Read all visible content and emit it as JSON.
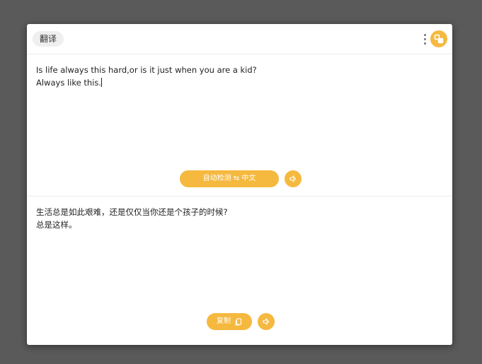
{
  "window": {
    "title": "翻译"
  },
  "source": {
    "text": "Is life always this hard,or is it just when you are a kid?\nAlways like this.",
    "language_button": "自动检测 ⇆ 中文"
  },
  "target": {
    "text": "生活总是如此艰难，还是仅仅当你还是个孩子的时候?\n总是这样。",
    "copy_label": "复制"
  },
  "icons": {
    "more": "more-vertical-icon",
    "switch": "switch-layout-icon",
    "speaker": "speaker-icon",
    "copy": "copy-icon"
  },
  "colors": {
    "accent": "#f5b93f",
    "backdrop": "#5a5a5a",
    "window": "#ffffff"
  }
}
